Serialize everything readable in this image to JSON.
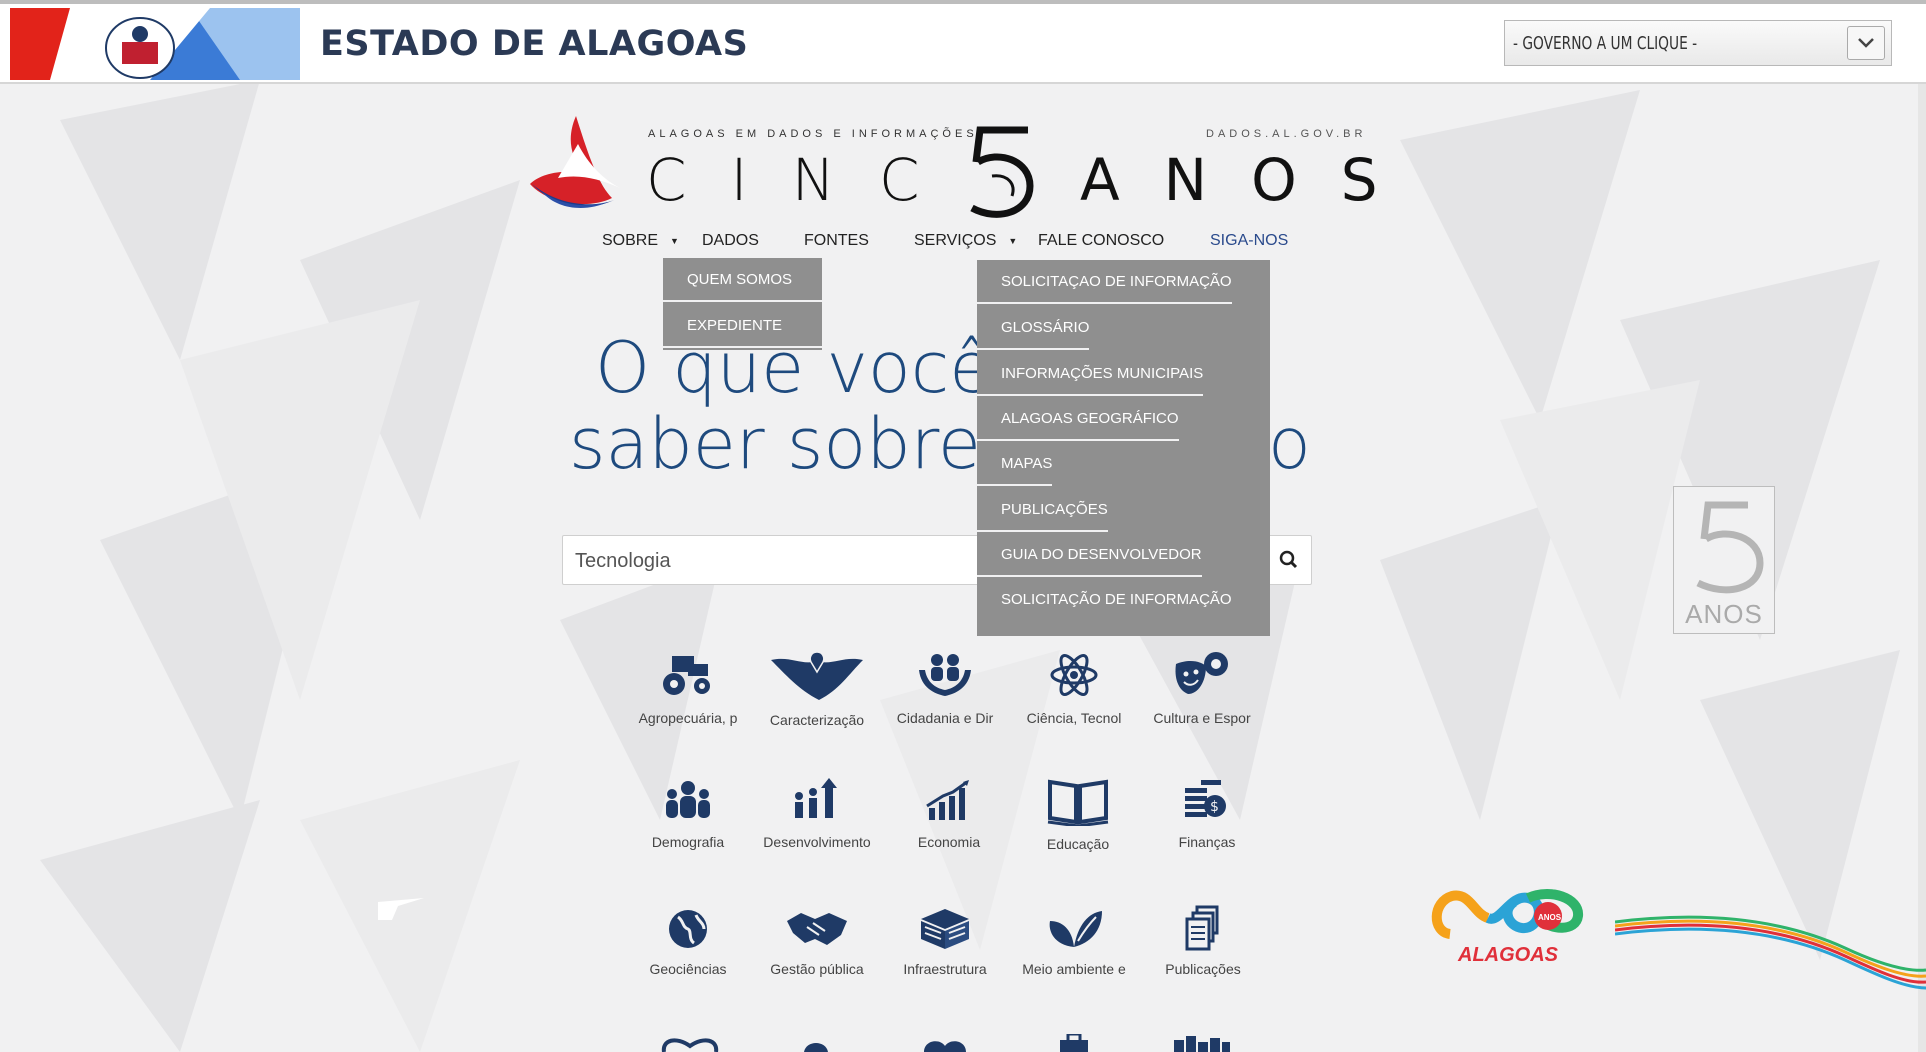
{
  "gov_bar": {
    "title": "ESTADO DE ALAGOAS",
    "select_value": "- GOVERNO A UM CLIQUE -"
  },
  "logo": {
    "tagline": "ALAGOAS EM DADOS E INFORMAÇÕES",
    "domain": "DADOS.AL.GOV.BR",
    "left_word": "CINC",
    "right_word": "ANOS"
  },
  "nav": {
    "items": [
      {
        "label": "SOBRE"
      },
      {
        "label": "DADOS"
      },
      {
        "label": "FONTES"
      },
      {
        "label": "SERVIÇOS"
      },
      {
        "label": "FALE CONOSCO"
      },
      {
        "label": "SIGA-NOS"
      }
    ]
  },
  "sobre_menu": [
    "QUEM SOMOS",
    "EXPEDIENTE"
  ],
  "servicos_menu": [
    "SOLICITAÇAO DE INFORMAÇÃO",
    "GLOSSÁRIO",
    "INFORMAÇÕES MUNICIPAIS",
    "ALAGOAS GEOGRÁFICO",
    "MAPAS",
    "PUBLICAÇÕES",
    "GUIA DO DESENVOLVEDOR",
    "SOLICITAÇÃO DE INFORMAÇÃO"
  ],
  "headline": {
    "line1": "O que você",
    "line2": "saber sobre",
    "trailing": "o"
  },
  "search": {
    "value": "Tecnologia"
  },
  "categories": [
    {
      "label": "Agropecuária, p",
      "icon": "tractor-icon"
    },
    {
      "label": "Caracterização",
      "icon": "map-pin-icon"
    },
    {
      "label": "Cidadania e Dir",
      "icon": "hands-people-icon"
    },
    {
      "label": "Ciência, Tecnol",
      "icon": "atom-icon"
    },
    {
      "label": "Cultura e Espor",
      "icon": "masks-ball-icon"
    },
    {
      "label": "Demografia",
      "icon": "people-group-icon"
    },
    {
      "label": "Desenvolvimento",
      "icon": "growth-people-icon"
    },
    {
      "label": "Economia",
      "icon": "bar-chart-icon"
    },
    {
      "label": "Educação",
      "icon": "open-book-icon"
    },
    {
      "label": "Finanças",
      "icon": "coins-icon"
    },
    {
      "label": "Geociências",
      "icon": "globe-icon"
    },
    {
      "label": "Gestão pública",
      "icon": "handshake-icon"
    },
    {
      "label": "Infraestrutura",
      "icon": "buildings-icon"
    },
    {
      "label": "Meio ambiente e",
      "icon": "leaves-icon"
    },
    {
      "label": "Publicações",
      "icon": "documents-icon"
    }
  ],
  "badge": {
    "number": "5",
    "text": "ANOS"
  },
  "al200": {
    "small": "ANOS",
    "text": "ALAGOAS"
  },
  "colors": {
    "brand_blue": "#1e4a7e",
    "icon_navy": "#1f3a66",
    "menu_gray": "#8f8f8f"
  }
}
